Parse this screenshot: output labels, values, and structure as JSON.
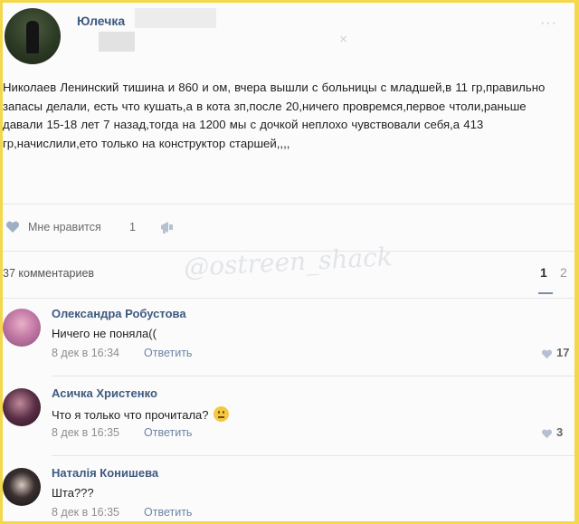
{
  "post": {
    "author": "Юлечка",
    "text": "Николаев Ленинский тишина и 860 и ом, вчера вышли с больницы с младшей,в 11 гр,правильно запасы делали, есть что кушать,а в кота зп,после 20,ничего провремся,первое чтоли,раньше давали 15-18 лет 7 назад,тогда на 1200 мы с дочкой неплохо чувствовали себя,а 413 гр,начислили,ето только на конструктор старшей,,,,",
    "likes_label": "Мне нравится",
    "likes_count": "1",
    "menu_glyph": "···",
    "blur_mark": "✕"
  },
  "comments_section": {
    "count_label": "37 комментариев",
    "pages": [
      "1",
      "2"
    ],
    "watermark": "@ostreen_shack"
  },
  "comments": [
    {
      "name": "Олександра Робустова",
      "text": "Ничего не поняла((",
      "date": "8 дек в 16:34",
      "reply": "Ответить",
      "likes": "17",
      "has_emoji": false
    },
    {
      "name": "Асичка Христенко",
      "text": "Что я только что прочитала?",
      "date": "8 дек в 16:35",
      "reply": "Ответить",
      "likes": "3",
      "has_emoji": true
    },
    {
      "name": "Наталія Конишева",
      "text": "Шта???",
      "date": "8 дек в 16:35",
      "reply": "Ответить",
      "likes": "",
      "has_emoji": false
    }
  ],
  "colors": {
    "frame": "#f2d84a",
    "link": "#3d5a80"
  },
  "icons": [
    "heart-icon",
    "share-icon",
    "more-icon",
    "neutral-face-icon"
  ]
}
